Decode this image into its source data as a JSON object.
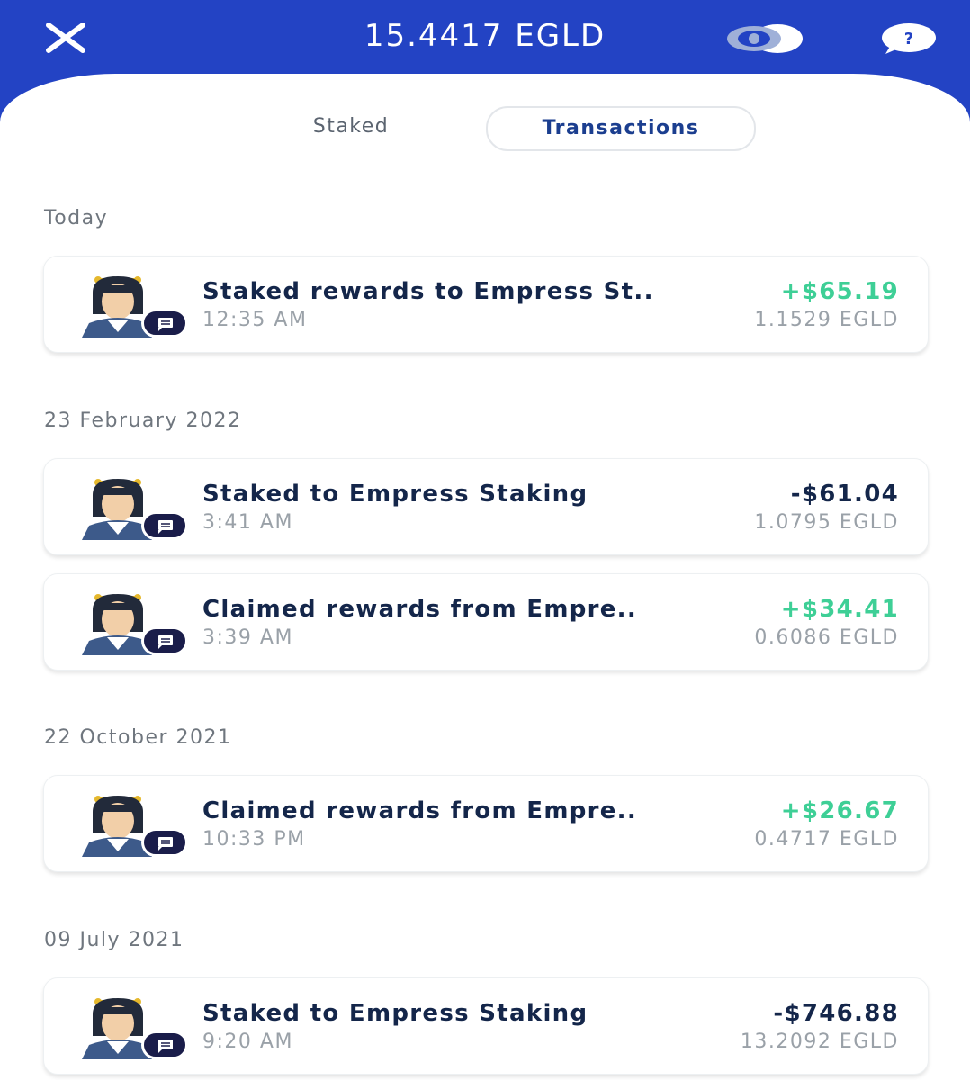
{
  "header": {
    "balance": "15.4417 EGLD",
    "colors": {
      "background": "#2343c4",
      "text": "#ffffff"
    },
    "icons": [
      "close-icon",
      "eye-icon",
      "help-icon"
    ]
  },
  "tabs": [
    {
      "label": "Staked",
      "active": false
    },
    {
      "label": "Transactions",
      "active": true
    }
  ],
  "colors": {
    "positive": "#3ecf96",
    "negative": "#14264a",
    "muted": "#9aa1a8",
    "badge": "#1a1d4a"
  },
  "sections": [
    {
      "label": "Today",
      "transactions": [
        {
          "title": "Staked rewards to Empress St..",
          "time": "12:35 AM",
          "amount": "+$65.19",
          "egld": "1.1529 EGLD",
          "direction": "positive"
        }
      ]
    },
    {
      "label": "23 February 2022",
      "transactions": [
        {
          "title": "Staked to Empress Staking",
          "time": "3:41 AM",
          "amount": "-$61.04",
          "egld": "1.0795 EGLD",
          "direction": "negative"
        },
        {
          "title": "Claimed rewards from Empre..",
          "time": "3:39 AM",
          "amount": "+$34.41",
          "egld": "0.6086 EGLD",
          "direction": "positive"
        }
      ]
    },
    {
      "label": "22 October 2021",
      "transactions": [
        {
          "title": "Claimed rewards from Empre..",
          "time": "10:33 PM",
          "amount": "+$26.67",
          "egld": "0.4717 EGLD",
          "direction": "positive"
        }
      ]
    },
    {
      "label": "09 July 2021",
      "transactions": [
        {
          "title": "Staked to Empress Staking",
          "time": "9:20 AM",
          "amount": "-$746.88",
          "egld": "13.2092 EGLD",
          "direction": "negative"
        }
      ]
    }
  ]
}
